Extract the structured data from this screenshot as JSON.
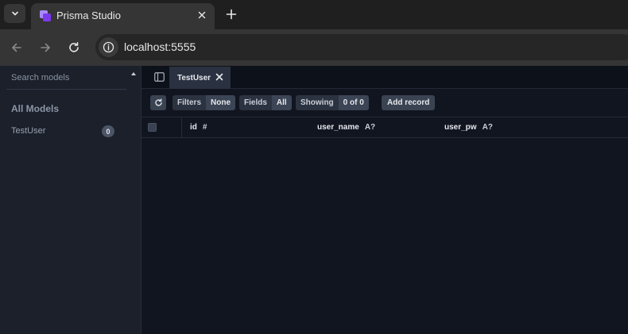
{
  "browser": {
    "tab_title": "Prisma Studio",
    "url": "localhost:5555"
  },
  "sidebar": {
    "search_placeholder": "Search models",
    "section_title": "All Models",
    "models": [
      {
        "name": "TestUser",
        "count": "0"
      }
    ]
  },
  "main": {
    "open_tab": "TestUser",
    "actions": {
      "filters_label": "Filters",
      "filters_value": "None",
      "fields_label": "Fields",
      "fields_value": "All",
      "showing_label": "Showing",
      "showing_value": "0 of 0",
      "add_record_label": "Add record"
    },
    "columns": [
      {
        "name": "id",
        "type": "#"
      },
      {
        "name": "user_name",
        "type": "A?"
      },
      {
        "name": "user_pw",
        "type": "A?"
      }
    ]
  },
  "icons": {
    "tab_list": "chevron-down-icon",
    "favicon": "prisma-studio-icon",
    "close": "close-icon",
    "new_tab": "plus-icon",
    "back": "arrow-left-icon",
    "forward": "arrow-right-icon",
    "reload": "reload-icon",
    "site_info": "info-icon",
    "refresh": "refresh-icon",
    "sidebar_toggle": "sidebar-toggle-icon"
  }
}
